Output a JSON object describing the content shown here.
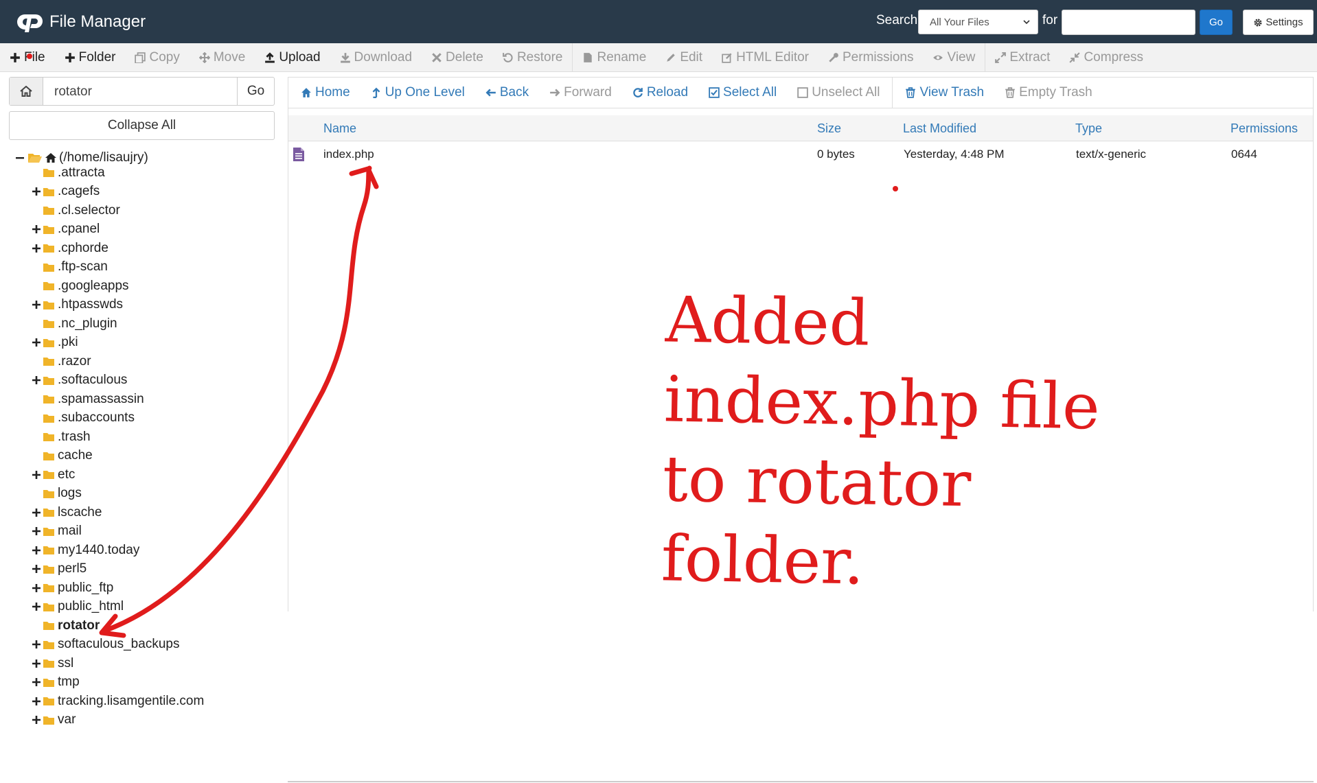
{
  "header": {
    "title": "File Manager",
    "search_label": "Search",
    "search_scope": "All Your Files",
    "for_label": "for",
    "search_value": "",
    "go_label": "Go",
    "settings_label": "Settings"
  },
  "toolbar": [
    {
      "label": "File",
      "icon": "plus-icon",
      "enabled": true
    },
    {
      "label": "Folder",
      "icon": "plus-icon",
      "enabled": true
    },
    {
      "label": "Copy",
      "icon": "copy-icon",
      "enabled": false
    },
    {
      "label": "Move",
      "icon": "move-icon",
      "enabled": false
    },
    {
      "label": "Upload",
      "icon": "upload-icon",
      "enabled": true
    },
    {
      "label": "Download",
      "icon": "download-icon",
      "enabled": false
    },
    {
      "label": "Delete",
      "icon": "delete-icon",
      "enabled": false
    },
    {
      "label": "Restore",
      "icon": "restore-icon",
      "enabled": false
    },
    {
      "label": "Rename",
      "icon": "rename-icon",
      "enabled": false
    },
    {
      "label": "Edit",
      "icon": "pencil-icon",
      "enabled": false
    },
    {
      "label": "HTML Editor",
      "icon": "html-editor-icon",
      "enabled": false
    },
    {
      "label": "Permissions",
      "icon": "key-icon",
      "enabled": false
    },
    {
      "label": "View",
      "icon": "eye-icon",
      "enabled": false
    },
    {
      "label": "Extract",
      "icon": "extract-icon",
      "enabled": false
    },
    {
      "label": "Compress",
      "icon": "compress-icon",
      "enabled": false
    }
  ],
  "left": {
    "path_value": "rotator",
    "go_label": "Go",
    "collapse_label": "Collapse All",
    "root_label": "(/home/lisaujry)",
    "tree": [
      {
        "name": ".attracta",
        "expandable": false
      },
      {
        "name": ".cagefs",
        "expandable": true
      },
      {
        "name": ".cl.selector",
        "expandable": false
      },
      {
        "name": ".cpanel",
        "expandable": true
      },
      {
        "name": ".cphorde",
        "expandable": true
      },
      {
        "name": ".ftp-scan",
        "expandable": false
      },
      {
        "name": ".googleapps",
        "expandable": false
      },
      {
        "name": ".htpasswds",
        "expandable": true
      },
      {
        "name": ".nc_plugin",
        "expandable": false
      },
      {
        "name": ".pki",
        "expandable": true
      },
      {
        "name": ".razor",
        "expandable": false
      },
      {
        "name": ".softaculous",
        "expandable": true
      },
      {
        "name": ".spamassassin",
        "expandable": false
      },
      {
        "name": ".subaccounts",
        "expandable": false
      },
      {
        "name": ".trash",
        "expandable": false
      },
      {
        "name": "cache",
        "expandable": false
      },
      {
        "name": "etc",
        "expandable": true
      },
      {
        "name": "logs",
        "expandable": false
      },
      {
        "name": "lscache",
        "expandable": true
      },
      {
        "name": "mail",
        "expandable": true
      },
      {
        "name": "my1440.today",
        "expandable": true
      },
      {
        "name": "perl5",
        "expandable": true
      },
      {
        "name": "public_ftp",
        "expandable": true
      },
      {
        "name": "public_html",
        "expandable": true
      },
      {
        "name": "rotator",
        "expandable": false,
        "current": true
      },
      {
        "name": "softaculous_backups",
        "expandable": true
      },
      {
        "name": "ssl",
        "expandable": true
      },
      {
        "name": "tmp",
        "expandable": true
      },
      {
        "name": "tracking.lisamgentile.com",
        "expandable": true
      },
      {
        "name": "var",
        "expandable": true
      }
    ]
  },
  "nav": [
    {
      "label": "Home",
      "icon": "home-icon",
      "enabled": true
    },
    {
      "label": "Up One Level",
      "icon": "level-up-icon",
      "enabled": true
    },
    {
      "label": "Back",
      "icon": "arrow-left-icon",
      "enabled": true
    },
    {
      "label": "Forward",
      "icon": "arrow-right-icon",
      "enabled": false
    },
    {
      "label": "Reload",
      "icon": "reload-icon",
      "enabled": true
    },
    {
      "label": "Select All",
      "icon": "checkbox-checked-icon",
      "enabled": true
    },
    {
      "label": "Unselect All",
      "icon": "checkbox-empty-icon",
      "enabled": false
    },
    {
      "label": "View Trash",
      "icon": "trash-icon",
      "enabled": true
    },
    {
      "label": "Empty Trash",
      "icon": "trash-icon",
      "enabled": false
    }
  ],
  "table": {
    "columns": [
      "Name",
      "Size",
      "Last Modified",
      "Type",
      "Permissions"
    ],
    "rows": [
      {
        "name": "index.php",
        "size": "0 bytes",
        "modified": "Yesterday, 4:48 PM",
        "type": "text/x-generic",
        "permissions": "0644"
      }
    ]
  },
  "annotation": {
    "text": "Added index.php file\nto rotator folder.",
    "color": "#e01c1c"
  },
  "colors": {
    "header_bg": "#293a4a",
    "link": "#337ab7",
    "folder": "#f0b429",
    "go_button": "#1f77cc"
  }
}
